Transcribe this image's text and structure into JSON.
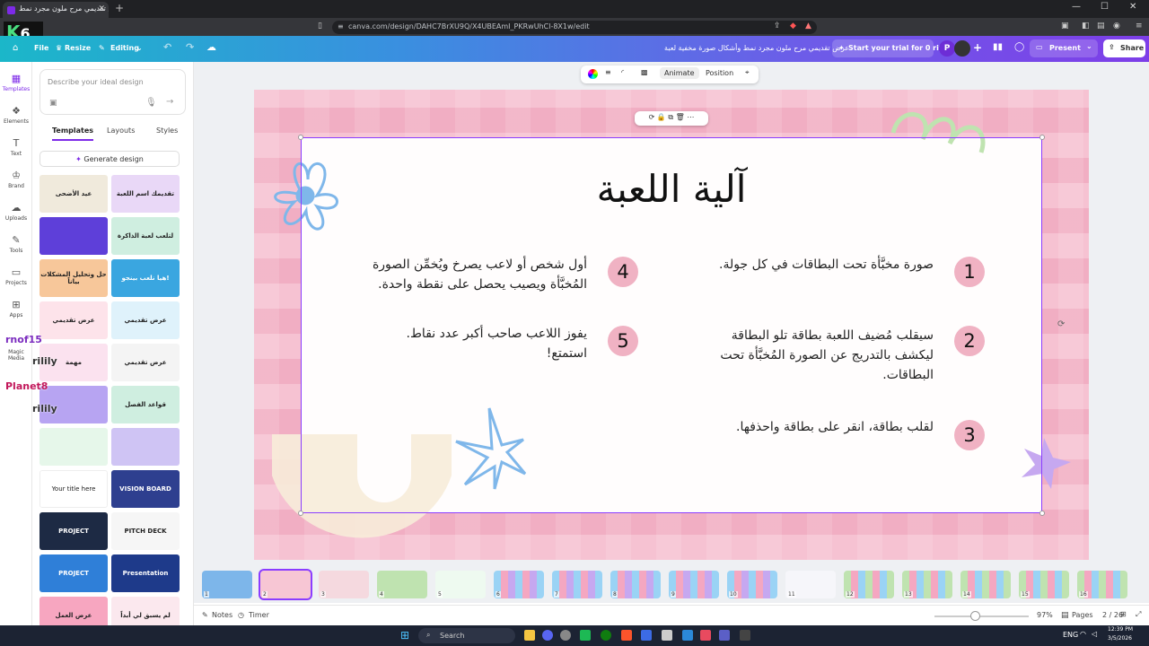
{
  "browser": {
    "tab_title": "عرض تقديمي مرح ملون مجرد نمط",
    "url": "canva.com/design/DAHC7BrXU9Q/X4UBEAmI_PKRwUhCl-8X1w/edit"
  },
  "header": {
    "file": "File",
    "resize": "Resize",
    "editing": "Editing",
    "doc_title": "عرض تقديمي مرح ملون مجرد نمط وأشكال صورة مخفية لعبة",
    "trial": "Start your trial for 0 riyals",
    "avatar_letter": "P",
    "present": "Present",
    "share": "Share"
  },
  "rail": {
    "items": [
      "Templates",
      "Elements",
      "Text",
      "Brand",
      "Uploads",
      "Tools",
      "Projects",
      "Apps",
      "Magic Media"
    ]
  },
  "panel": {
    "prompt_placeholder": "Describe your ideal design",
    "tabs": [
      "Templates",
      "Layouts",
      "Styles"
    ],
    "generate": "Generate design",
    "thumbs": [
      "عيد الأضحى",
      "تقديمك اسم اللعبة",
      "",
      "لتلعب لعبة الذاكرة",
      "حل وتحليل المشكلات بياناً",
      "هيا نلعب بينجو!",
      "عرض تقديمي",
      "عرض تقديمي",
      "مهمة",
      "عرض تقديمي",
      "",
      "قواعد الفصل",
      "",
      "",
      "Your title here",
      "VISION BOARD",
      "PROJECT",
      "PITCH DECK",
      "PROJECT",
      "Presentation",
      "عرض العمل",
      "لم يسبق لي أبداً"
    ]
  },
  "toolbar": {
    "animate": "Animate",
    "position": "Position"
  },
  "slide": {
    "title": "آلية اللعبة",
    "items": [
      {
        "num": "1",
        "text": "صورة مخبَّأة تحت البطاقات في كل جولة."
      },
      {
        "num": "2",
        "text": "سيقلب مُضيف اللعبة بطاقة تلو البطاقة ليكشف بالتدريج عن الصورة المُخبَّأة تحت البطاقات."
      },
      {
        "num": "3",
        "text": "لقلب بطاقة، انقر على بطاقة واحذفها."
      },
      {
        "num": "4",
        "text": "أول شخص أو لاعب يصرخ ويُخمِّن الصورة المُخبَّأة ويصيب يحصل على نقطة واحدة."
      },
      {
        "num": "5",
        "text": "يفوز اللاعب صاحب أكبر عدد نقاط. استمتع!"
      }
    ]
  },
  "filmstrip": {
    "pages": [
      "1",
      "2",
      "3",
      "4",
      "5",
      "6",
      "7",
      "8",
      "9",
      "10",
      "11",
      "12",
      "13",
      "14",
      "15",
      "16"
    ]
  },
  "bottom": {
    "notes": "Notes",
    "timer": "Timer",
    "zoom": "97%",
    "pages": "Pages",
    "page_count": "2 / 26"
  },
  "taskbar": {
    "search": "Search",
    "lang": "ENG",
    "time": "12:39 PM",
    "date": "3/5/2026"
  },
  "overlay": {
    "logo": "K",
    "logo_num": "6",
    "name1": "rnof15",
    "name2": "rilily",
    "name3": "Planet8",
    "name4": "rilily"
  },
  "colors": {
    "accent": "#8b3dff",
    "slide_pink": "#f1aec3",
    "number_circle": "#f0b2c3"
  }
}
